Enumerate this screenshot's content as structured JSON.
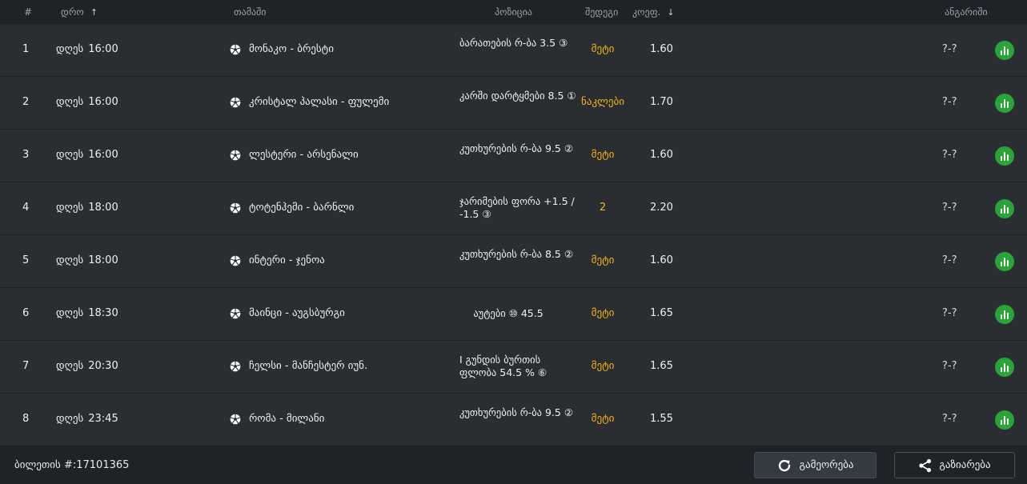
{
  "header": {
    "num": "#",
    "time": "დრო",
    "time_sort": "↑",
    "game": "თამაში",
    "position": "პოზიცია",
    "outcome": "შედეგი",
    "odds": "კოეფ.",
    "odds_sort": "↓",
    "result": "ანგარიში"
  },
  "rows": [
    {
      "num": "1",
      "day": "დღეს",
      "time": "16:00",
      "match": "მონაკო - ბრესტი",
      "position": "ბარათების რ-ბა 3.5 ③",
      "outcome": "მეტი",
      "odds": "1.60",
      "score": "?-?"
    },
    {
      "num": "2",
      "day": "დღეს",
      "time": "16:00",
      "match": "კრისტალ პალასი - ფულემი",
      "position": "კარში დარტყმები 8.5 ①",
      "outcome": "ნაკლები",
      "odds": "1.70",
      "score": "?-?"
    },
    {
      "num": "3",
      "day": "დღეს",
      "time": "16:00",
      "match": "ლესტერი - არსენალი",
      "position": "კუთხურების რ-ბა 9.5 ②",
      "outcome": "მეტი",
      "odds": "1.60",
      "score": "?-?"
    },
    {
      "num": "4",
      "day": "დღეს",
      "time": "18:00",
      "match": "ტოტენჰემი - ბარნლი",
      "position": "ჯარიმების ფორა +1.5 / -1.5 ③",
      "outcome": "2",
      "odds": "2.20",
      "score": "?-?"
    },
    {
      "num": "5",
      "day": "დღეს",
      "time": "18:00",
      "match": "ინტერი - ჯენოა",
      "position": "კუთხურების რ-ბა 8.5 ②",
      "outcome": "მეტი",
      "odds": "1.60",
      "score": "?-?"
    },
    {
      "num": "6",
      "day": "დღეს",
      "time": "18:30",
      "match": "მაინცი - აუგსბურგი",
      "position": "აუტები ⑩ 45.5",
      "outcome": "მეტი",
      "odds": "1.65",
      "score": "?-?"
    },
    {
      "num": "7",
      "day": "დღეს",
      "time": "20:30",
      "match": "ჩელსი - მანჩესტერ იუნ.",
      "position": "I გუნდის ბურთის ფლობა 54.5 % ⑥",
      "outcome": "მეტი",
      "odds": "1.65",
      "score": "?-?"
    },
    {
      "num": "8",
      "day": "დღეს",
      "time": "23:45",
      "match": "რომა - მილანი",
      "position": "კუთხურების რ-ბა 9.5 ②",
      "outcome": "მეტი",
      "odds": "1.55",
      "score": "?-?"
    }
  ],
  "footer": {
    "ticket": "ბილეთის #:17101365",
    "repeat": "გამეორება",
    "share": "გაზიარება"
  },
  "colors": {
    "outcome": "#f5b315",
    "live": "#2aa438",
    "row_bg": "#2a2e33",
    "page_bg": "#1f2327"
  },
  "icons": {
    "sport": "soccer-ball-icon",
    "live": "live-stats-icon",
    "repeat": "refresh-icon",
    "share": "share-icon"
  }
}
